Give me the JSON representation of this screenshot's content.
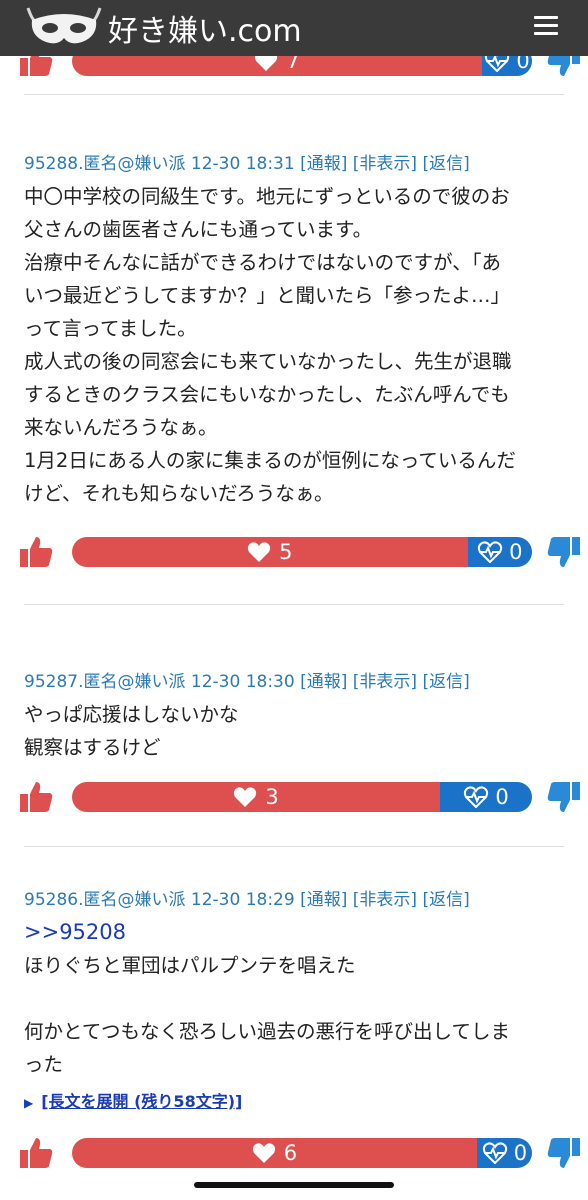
{
  "header": {
    "site_name": "好き嫌い.com"
  },
  "colors": {
    "like": "#de5050",
    "dislike": "#1a73c8",
    "header_bg": "#3a3a3a",
    "link": "#2a7ab8"
  },
  "top_votes": {
    "likes": "7",
    "dislikes": "0"
  },
  "comments": [
    {
      "id": "95288.",
      "author": "匿名@嫌い派",
      "timestamp": "12-30 18:31",
      "report": "[通報]",
      "hide": "[非表示]",
      "reply": "[返信]",
      "lines": [
        "中〇中学校の同級生です。地元にずっといるので彼のお",
        "父さんの歯医者さんにも通っています。",
        "治療中そんなに話ができるわけではないのですが、「あ",
        "いつ最近どうしてますか？」と聞いたら「参ったよ…」",
        "って言ってました。",
        "成人式の後の同窓会にも来ていなかったし、先生が退職",
        "するときのクラス会にもいなかったし、たぶん呼んでも",
        "来ないんだろうなぁ。",
        "1月2日にある人の家に集まるのが恒例になっているんだ",
        "けど、それも知らないだろうなぁ。"
      ],
      "likes": "5",
      "dislikes": "0",
      "like_ratio": 0.86
    },
    {
      "id": "95287.",
      "author": "匿名@嫌い派",
      "timestamp": "12-30 18:30",
      "report": "[通報]",
      "hide": "[非表示]",
      "reply": "[返信]",
      "lines": [
        "やっぱ応援はしないかな",
        "観察はするけど"
      ],
      "likes": "3",
      "dislikes": "0",
      "like_ratio": 0.8
    },
    {
      "id": "95286.",
      "author": "匿名@嫌い派",
      "timestamp": "12-30 18:29",
      "report": "[通報]",
      "hide": "[非表示]",
      "reply": "[返信]",
      "anchor": ">>95208",
      "lines": [
        "ほりぐちと軍団はパルプンテを唱えた",
        "",
        "何かとてつもなく恐ろしい過去の悪行を呼び出してしま",
        "った"
      ],
      "expand": "[長文を展開 (残り58文字)]",
      "likes": "6",
      "dislikes": "0",
      "like_ratio": 0.88
    }
  ],
  "icons": {
    "logo": "mask-logo-icon",
    "menu": "hamburger-menu-icon",
    "like": "thumbs-up-icon",
    "dislike": "thumbs-down-icon",
    "heart": "heart-icon",
    "pulse": "heart-pulse-icon"
  }
}
